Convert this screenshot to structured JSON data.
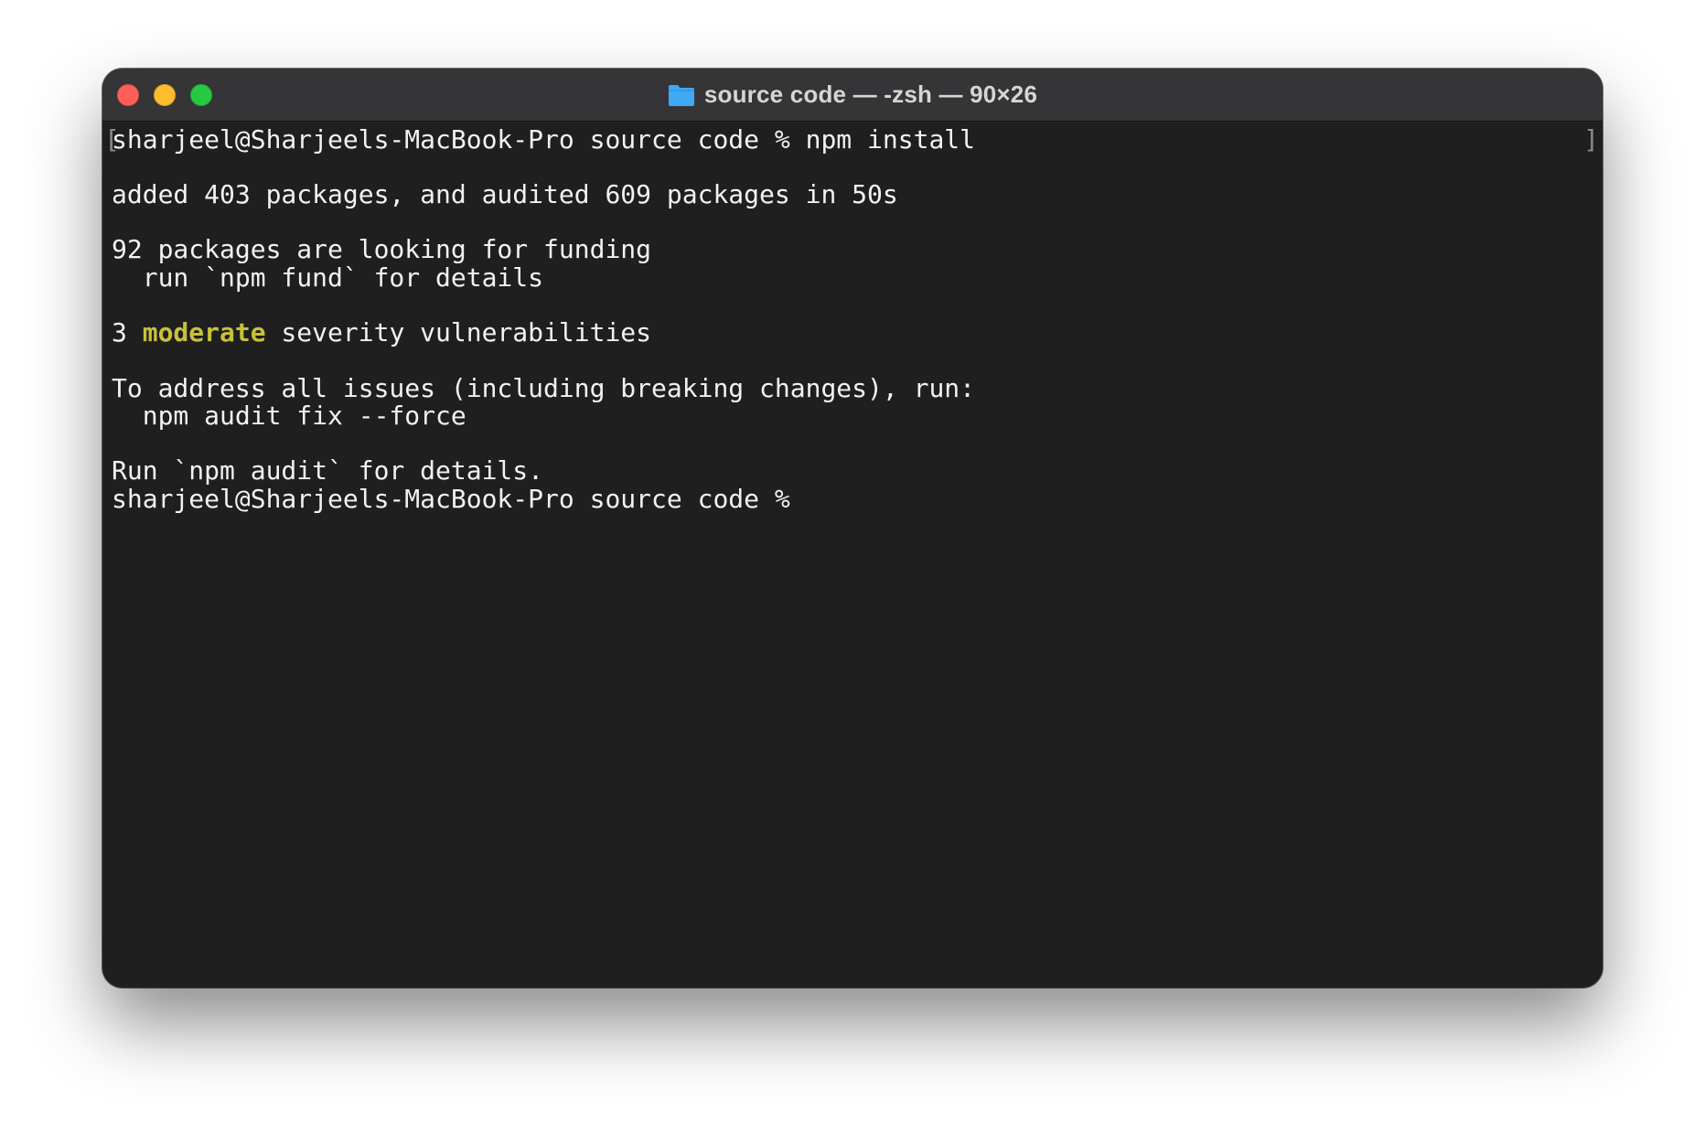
{
  "window": {
    "title": "source code — -zsh — 90×26",
    "title_icon": "folder-icon",
    "traffic_lights": [
      "close-button",
      "minimize-button",
      "zoom-button"
    ]
  },
  "colors": {
    "background": "#1f1f1f",
    "text": "#f2f2f2",
    "moderate": "#c7c13b",
    "folder": "#3fa9f5"
  },
  "terminal": {
    "prompt_1": "sharjeel@Sharjeels-MacBook-Pro source code % npm install",
    "added": "added 403 packages, and audited 609 packages in 50s",
    "funding": "92 packages are looking for funding",
    "fund_hint": "  run `npm fund` for details",
    "vuln_count": "3 ",
    "vuln_severity": "moderate",
    "vuln_rest": " severity vulnerabilities",
    "address": "To address all issues (including breaking changes), run:",
    "fix_cmd": "  npm audit fix --force",
    "audit_hint": "Run `npm audit` for details.",
    "prompt_2": "sharjeel@Sharjeels-MacBook-Pro source code % ",
    "mark_open": "[",
    "mark_close": "]"
  }
}
